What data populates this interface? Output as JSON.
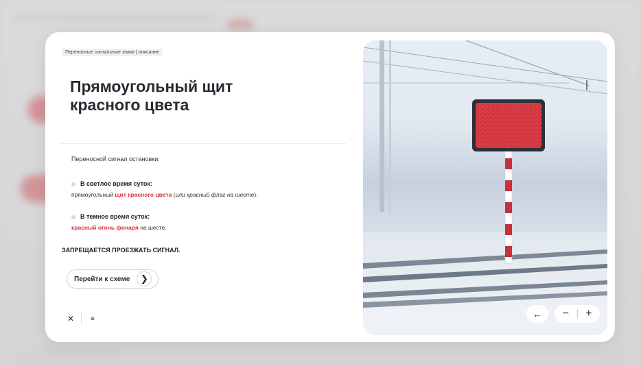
{
  "breadcrumb": "Переносные сигнальные знаки  |  описание",
  "title_line1": "Прямоугольный щит",
  "title_line2": "красного цвета",
  "intro": "Переносной сигнал остановки:",
  "items": [
    {
      "head": "В светлое время суток:",
      "text_a": "прямоугольный ",
      "text_red": "щит красного цвета",
      "text_b": " (",
      "text_italic": "или красный флаг на шесте",
      "text_c": ")."
    },
    {
      "head": "В темное время суток:",
      "text_red": "красный огонь фонаря",
      "text_b": " на шесте."
    }
  ],
  "warning": "ЗАПРЕЩАЕТСЯ ПРОЕЗЖАТЬ СИГНАЛ.",
  "schema_button": "Перейти к схеме",
  "icons": {
    "close": "close-icon",
    "menu": "menu-icon",
    "arrow": "arrow-right-icon",
    "back": "arrow-left-icon"
  },
  "colors": {
    "accent_red": "#e0303e",
    "sign_red": "#d4363f"
  }
}
